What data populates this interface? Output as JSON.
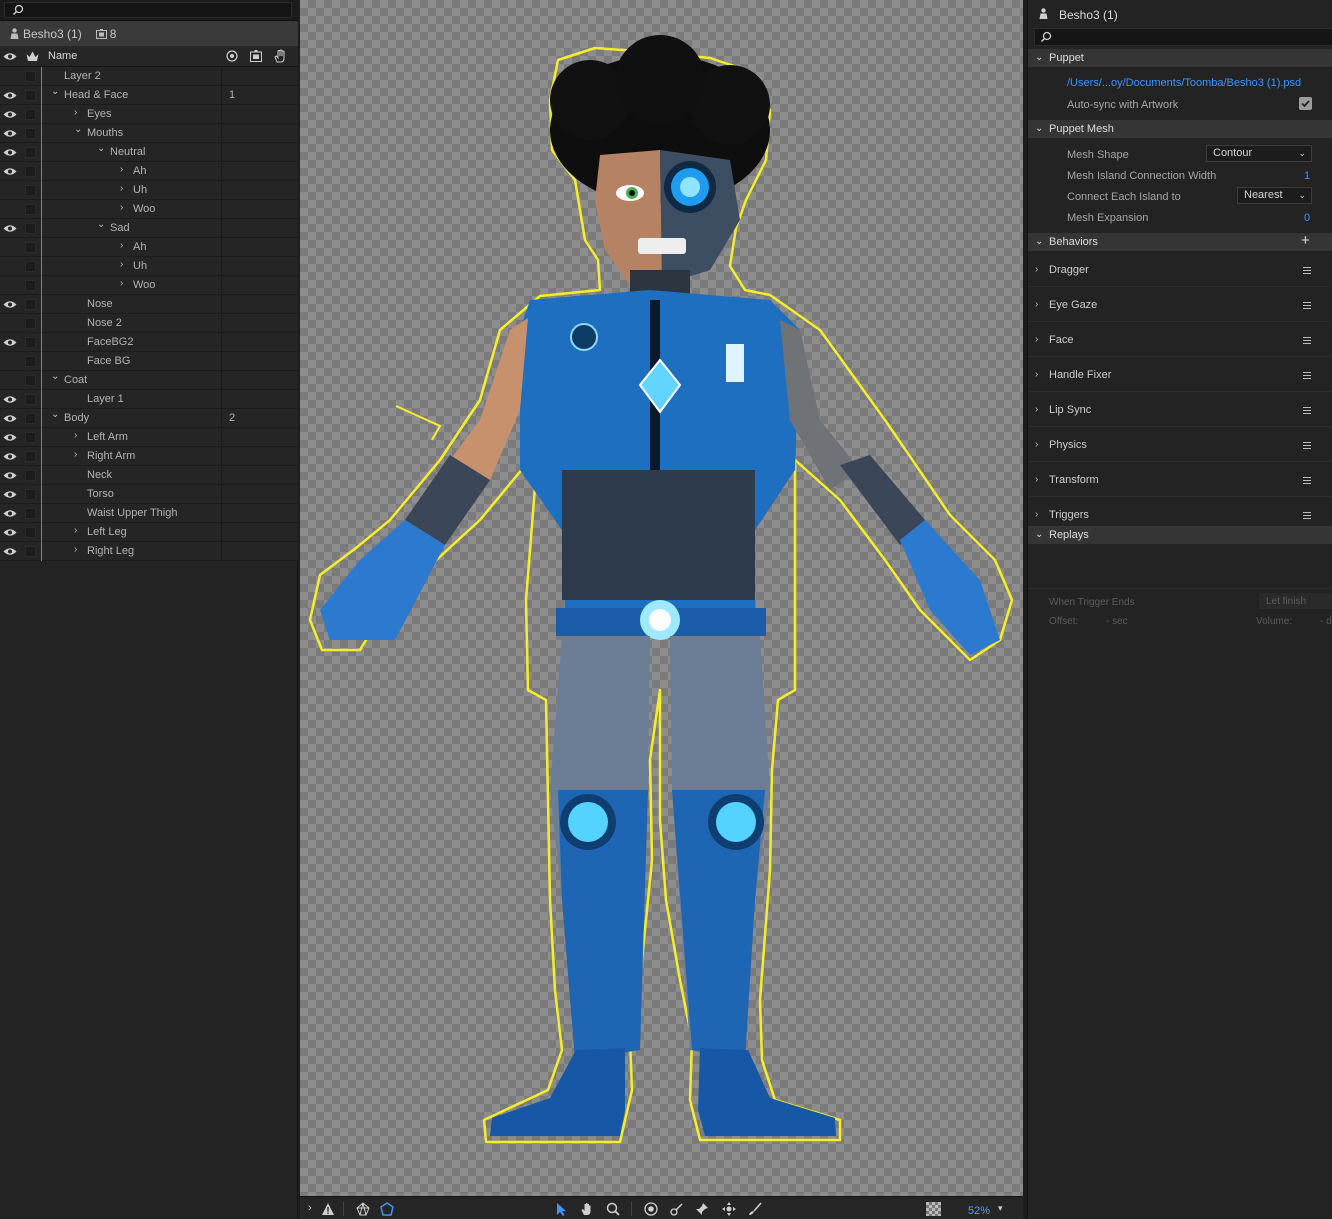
{
  "left_panel": {
    "puppet_name": "Besho3 (1)",
    "handle_count": "8",
    "column_name": "Name",
    "layers": [
      {
        "label": "Layer 2",
        "depth": 0,
        "chevron": "",
        "visible": false,
        "num": ""
      },
      {
        "label": "Head & Face",
        "depth": 0,
        "chevron": "down",
        "visible": true,
        "num": "1"
      },
      {
        "label": "Eyes",
        "depth": 1,
        "chevron": "right",
        "visible": true,
        "num": ""
      },
      {
        "label": "Mouths",
        "depth": 1,
        "chevron": "down",
        "visible": true,
        "num": ""
      },
      {
        "label": "Neutral",
        "depth": 2,
        "chevron": "down",
        "visible": true,
        "num": ""
      },
      {
        "label": "Ah",
        "depth": 3,
        "chevron": "right",
        "visible": true,
        "num": ""
      },
      {
        "label": "Uh",
        "depth": 3,
        "chevron": "right",
        "visible": false,
        "num": ""
      },
      {
        "label": "Woo",
        "depth": 3,
        "chevron": "right",
        "visible": false,
        "num": ""
      },
      {
        "label": "Sad",
        "depth": 2,
        "chevron": "down",
        "visible": true,
        "num": ""
      },
      {
        "label": "Ah",
        "depth": 3,
        "chevron": "right",
        "visible": false,
        "num": ""
      },
      {
        "label": "Uh",
        "depth": 3,
        "chevron": "right",
        "visible": false,
        "num": ""
      },
      {
        "label": "Woo",
        "depth": 3,
        "chevron": "right",
        "visible": false,
        "num": ""
      },
      {
        "label": "Nose",
        "depth": 1,
        "chevron": "",
        "visible": true,
        "num": ""
      },
      {
        "label": "Nose 2",
        "depth": 1,
        "chevron": "",
        "visible": false,
        "num": ""
      },
      {
        "label": "FaceBG2",
        "depth": 1,
        "chevron": "",
        "visible": true,
        "num": ""
      },
      {
        "label": "Face BG",
        "depth": 1,
        "chevron": "",
        "visible": false,
        "num": ""
      },
      {
        "label": "Coat",
        "depth": 0,
        "chevron": "down",
        "visible": false,
        "num": ""
      },
      {
        "label": "Layer 1",
        "depth": 1,
        "chevron": "",
        "visible": true,
        "num": ""
      },
      {
        "label": "Body",
        "depth": 0,
        "chevron": "down",
        "visible": true,
        "num": "2"
      },
      {
        "label": "Left Arm",
        "depth": 1,
        "chevron": "right",
        "visible": true,
        "num": ""
      },
      {
        "label": "Right Arm",
        "depth": 1,
        "chevron": "right",
        "visible": true,
        "num": ""
      },
      {
        "label": "Neck",
        "depth": 1,
        "chevron": "",
        "visible": true,
        "num": ""
      },
      {
        "label": "Torso",
        "depth": 1,
        "chevron": "",
        "visible": true,
        "num": ""
      },
      {
        "label": "Waist Upper Thigh",
        "depth": 1,
        "chevron": "",
        "visible": true,
        "num": ""
      },
      {
        "label": "Left Leg",
        "depth": 1,
        "chevron": "right",
        "visible": true,
        "num": ""
      },
      {
        "label": "Right Leg",
        "depth": 1,
        "chevron": "right",
        "visible": true,
        "num": ""
      }
    ]
  },
  "toolbar": {
    "zoom": "52%"
  },
  "right_panel": {
    "title": "Besho3 (1)",
    "puppet_section": "Puppet",
    "psd_path": "/Users/...oy/Documents/Toomba/Besho3 (1).psd",
    "auto_sync_label": "Auto-sync with Artwork",
    "auto_sync_checked": true,
    "mesh_section": "Puppet Mesh",
    "mesh_shape_label": "Mesh Shape",
    "mesh_shape_value": "Contour",
    "island_width_label": "Mesh Island Connection Width",
    "island_width_value": "1",
    "connect_label": "Connect Each Island to",
    "connect_value": "Nearest",
    "expansion_label": "Mesh Expansion",
    "expansion_value": "0",
    "behaviors_section": "Behaviors",
    "behaviors": [
      "Dragger",
      "Eye Gaze",
      "Face",
      "Handle Fixer",
      "Lip Sync",
      "Physics",
      "Transform",
      "Triggers"
    ],
    "replays_section": "Replays",
    "when_trigger_label": "When Trigger Ends",
    "when_trigger_value": "Let finish",
    "offset_label": "Offset:",
    "offset_value": "- sec",
    "volume_label": "Volume:",
    "volume_value": "- d"
  },
  "colors": {
    "accent_blue": "#3d95ff",
    "mesh_outline": "#f4ee2a",
    "suit_blue": "#1f6fc0"
  }
}
